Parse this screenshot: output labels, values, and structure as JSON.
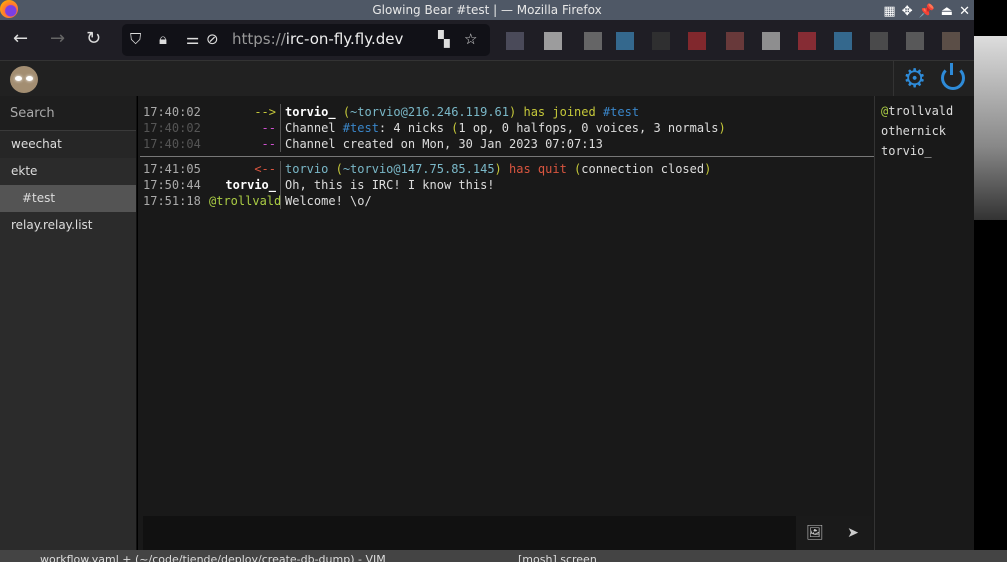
{
  "window": {
    "title": "Glowing Bear #test | — Mozilla Firefox"
  },
  "browser": {
    "url_protocol": "https://",
    "url_host": "irc-on-fly.fly.dev"
  },
  "sidebar": {
    "search_placeholder": "Search",
    "items": [
      {
        "label": "weechat"
      },
      {
        "label": "ekte"
      },
      {
        "label": "#test",
        "active": true
      },
      {
        "label": "relay.relay.list"
      }
    ]
  },
  "chat": {
    "lines": [
      {
        "time": "17:40:02",
        "prefix": "-->",
        "nick": "torvio_",
        "host": "~torvio@216.246.119.61",
        "action": "has joined",
        "channel": "#test"
      },
      {
        "time": "17:40:02",
        "prefix": "--",
        "text_a": "Channel ",
        "channel": "#test",
        "text_b": ": 4 nicks ",
        "paren_open": "(",
        "text_c": "1 op, 0 halfops, 0 voices, 3 normals",
        "paren_close": ")"
      },
      {
        "time": "17:40:04",
        "prefix": "--",
        "text": "Channel created on Mon, 30 Jan 2023 07:07:13"
      },
      {
        "time": "17:41:05",
        "prefix": "<--",
        "nick": "torvio",
        "host": "~torvio@147.75.85.145",
        "action": "has quit",
        "reason": "connection closed"
      },
      {
        "time": "17:50:44",
        "prefix": "torvio_",
        "text": "Oh, this is IRC! I know this!"
      },
      {
        "time": "17:51:18",
        "prefix": "@trollvald",
        "text": "Welcome! \\o/"
      }
    ]
  },
  "nicklist": [
    {
      "mode": "@",
      "nick": "trollvald"
    },
    {
      "mode": "",
      "nick": "othernick"
    },
    {
      "mode": "",
      "nick": "torvio_"
    }
  ],
  "taskbar": {
    "items": [
      "workflow.yaml + (~/code/tiende/deploy/create-db-dump) - VIM",
      "[mosh] screen"
    ]
  },
  "colors": {
    "accent": "#2e8bd8",
    "join": "#c5c83a",
    "quit": "#d9553f",
    "channel": "#3a86c9"
  }
}
